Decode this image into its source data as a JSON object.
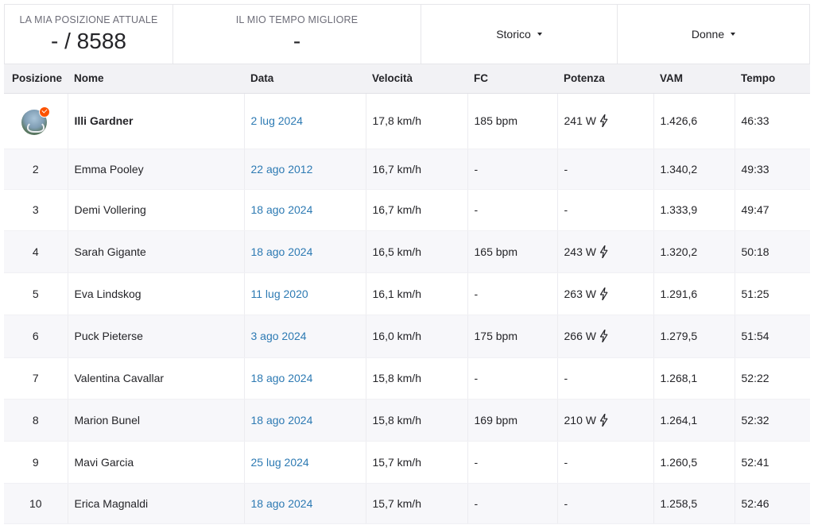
{
  "stats": {
    "position_label": "LA MIA POSIZIONE ATTUALE",
    "position_value": "- / 8588",
    "best_time_label": "IL MIO TEMPO MIGLIORE",
    "best_time_value": "-"
  },
  "filters": {
    "period": "Storico",
    "gender": "Donne"
  },
  "columns": [
    "Posizione",
    "Nome",
    "Data",
    "Velocità",
    "FC",
    "Potenza",
    "VAM",
    "Tempo"
  ],
  "rows": [
    {
      "pos": "",
      "name": "Illi Gardner",
      "date": "2 lug 2024",
      "speed": "17,8 km/h",
      "hr": "185 bpm",
      "power": "241 W",
      "power_icon": true,
      "vam": "1.426,6",
      "time": "46:33"
    },
    {
      "pos": "2",
      "name": "Emma Pooley",
      "date": "22 ago 2012",
      "speed": "16,7 km/h",
      "hr": "-",
      "power": "-",
      "power_icon": false,
      "vam": "1.340,2",
      "time": "49:33"
    },
    {
      "pos": "3",
      "name": "Demi Vollering",
      "date": "18 ago 2024",
      "speed": "16,7 km/h",
      "hr": "-",
      "power": "-",
      "power_icon": false,
      "vam": "1.333,9",
      "time": "49:47"
    },
    {
      "pos": "4",
      "name": "Sarah Gigante",
      "date": "18 ago 2024",
      "speed": "16,5 km/h",
      "hr": "165 bpm",
      "power": "243 W",
      "power_icon": true,
      "vam": "1.320,2",
      "time": "50:18"
    },
    {
      "pos": "5",
      "name": "Eva Lindskog",
      "date": "11 lug 2020",
      "speed": "16,1 km/h",
      "hr": "-",
      "power": "263 W",
      "power_icon": true,
      "vam": "1.291,6",
      "time": "51:25"
    },
    {
      "pos": "6",
      "name": "Puck Pieterse",
      "date": "3 ago 2024",
      "speed": "16,0 km/h",
      "hr": "175 bpm",
      "power": "266 W",
      "power_icon": true,
      "vam": "1.279,5",
      "time": "51:54"
    },
    {
      "pos": "7",
      "name": "Valentina Cavallar",
      "date": "18 ago 2024",
      "speed": "15,8 km/h",
      "hr": "-",
      "power": "-",
      "power_icon": false,
      "vam": "1.268,1",
      "time": "52:22"
    },
    {
      "pos": "8",
      "name": "Marion Bunel",
      "date": "18 ago 2024",
      "speed": "15,8 km/h",
      "hr": "169 bpm",
      "power": "210 W",
      "power_icon": true,
      "vam": "1.264,1",
      "time": "52:32"
    },
    {
      "pos": "9",
      "name": "Mavi Garcia",
      "date": "25 lug 2024",
      "speed": "15,7 km/h",
      "hr": "-",
      "power": "-",
      "power_icon": false,
      "vam": "1.260,5",
      "time": "52:41"
    },
    {
      "pos": "10",
      "name": "Erica Magnaldi",
      "date": "18 ago 2024",
      "speed": "15,7 km/h",
      "hr": "-",
      "power": "-",
      "power_icon": false,
      "vam": "1.258,5",
      "time": "52:46"
    }
  ],
  "icons": {
    "power": "lightning-bolt-icon",
    "crown_badge": "check-badge-icon",
    "dropdown": "caret-down-icon"
  },
  "colors": {
    "link": "#2d7ab3",
    "badge": "#fc5200",
    "header_bg": "#f2f2f5"
  }
}
